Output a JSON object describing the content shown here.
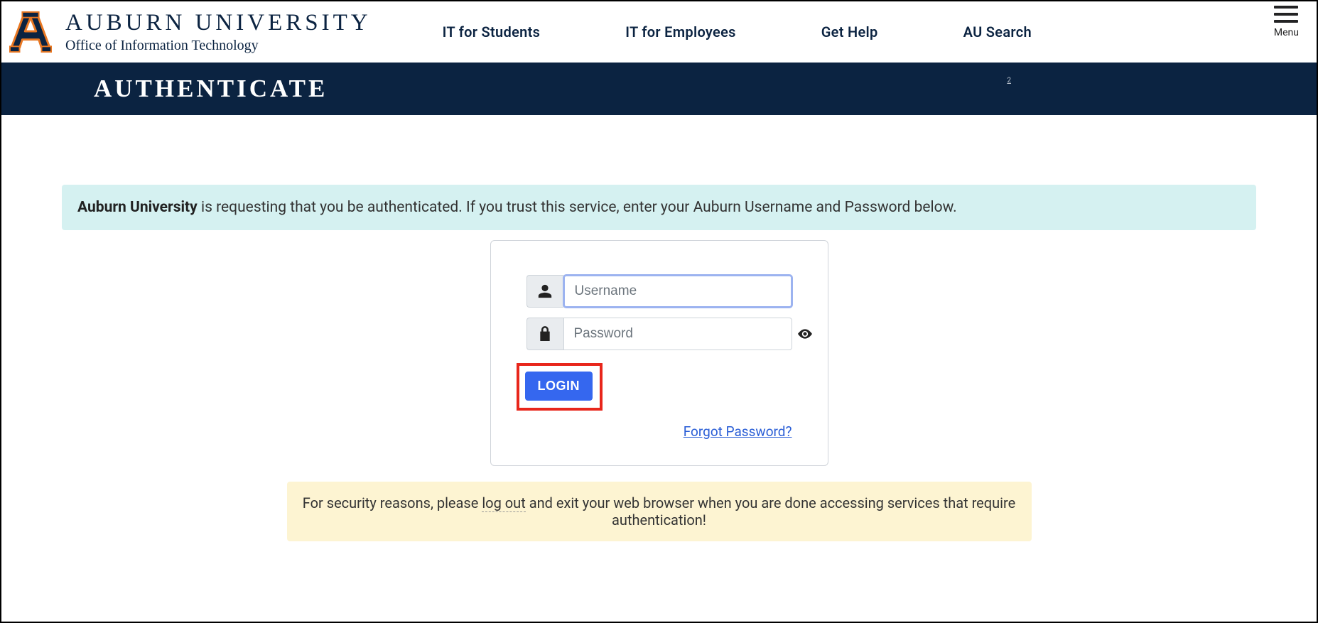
{
  "header": {
    "org_title": "AUBURN UNIVERSITY",
    "org_sub": "Office of Information Technology",
    "nav": {
      "students": "IT for Students",
      "employees": "IT for Employees",
      "help": "Get Help",
      "search": "AU Search"
    },
    "menu_label": "Menu"
  },
  "titlebar": {
    "title": "AUTHENTICATE",
    "two_link": "2"
  },
  "info": {
    "strong": "Auburn University",
    "rest": " is requesting that you be authenticated. If you trust this service, enter your Auburn Username and Password below."
  },
  "login": {
    "username_placeholder": "Username",
    "password_placeholder": "Password",
    "login_label": "LOGIN",
    "forgot_label": "Forgot Password?"
  },
  "security": {
    "pre": "For security reasons, please ",
    "emph": "log out",
    "post": " and exit your web browser when you are done accessing services that require authentication!"
  },
  "icons": {
    "user": "user-icon",
    "lock": "lock-icon",
    "eye": "eye-icon",
    "hamburger": "hamburger-icon"
  }
}
